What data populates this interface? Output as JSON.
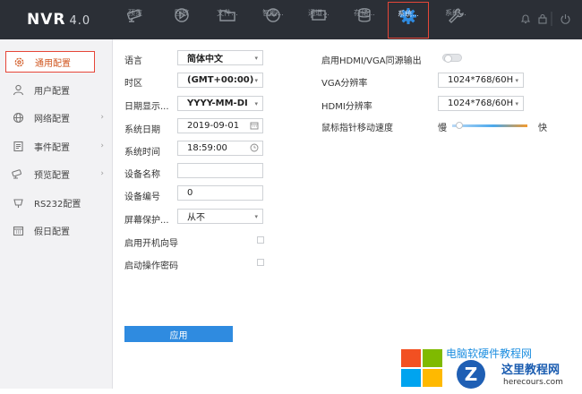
{
  "brand": {
    "name": "NVR",
    "version": "4.0"
  },
  "topnav": [
    {
      "id": "preview",
      "label": "预览",
      "icon": "camera-icon"
    },
    {
      "id": "playback",
      "label": "回放",
      "icon": "play-icon"
    },
    {
      "id": "file",
      "label": "文件...",
      "icon": "folder-icon"
    },
    {
      "id": "smart",
      "label": "智能...",
      "icon": "smart-analysis-icon"
    },
    {
      "id": "channel",
      "label": "通道...",
      "icon": "channel-icon"
    },
    {
      "id": "storage",
      "label": "存储...",
      "icon": "database-icon"
    },
    {
      "id": "system",
      "label": "系统...",
      "icon": "gear-icon",
      "active": true
    },
    {
      "id": "maintenance",
      "label": "系统...",
      "icon": "wrench-icon"
    }
  ],
  "sidebar": {
    "items": [
      {
        "label": "通用配置",
        "icon": "gear-icon",
        "active": true,
        "arrow": false
      },
      {
        "label": "用户配置",
        "icon": "user-icon",
        "arrow": false
      },
      {
        "label": "网络配置",
        "icon": "globe-icon",
        "arrow": true
      },
      {
        "label": "事件配置",
        "icon": "event-icon",
        "arrow": true
      },
      {
        "label": "预览配置",
        "icon": "camera-icon",
        "arrow": true
      },
      {
        "label": "RS232配置",
        "icon": "rs232-icon",
        "arrow": false
      },
      {
        "label": "假日配置",
        "icon": "calendar-icon",
        "arrow": false
      }
    ]
  },
  "form": {
    "language": {
      "label": "语言",
      "value": "简体中文"
    },
    "timezone": {
      "label": "时区",
      "value": "(GMT+00:00)"
    },
    "date_format": {
      "label": "日期显示...",
      "value": "YYYY-MM-DI"
    },
    "system_date": {
      "label": "系统日期",
      "value": "2019-09-01"
    },
    "system_time": {
      "label": "系统时间",
      "value": "18:59:00"
    },
    "device_name": {
      "label": "设备名称",
      "value": ""
    },
    "device_number": {
      "label": "设备编号",
      "value": "0"
    },
    "screensaver": {
      "label": "屏幕保护...",
      "value": "从不"
    },
    "startup_wizard": {
      "label": "启用开机向导",
      "checked": false
    },
    "operation_password": {
      "label": "启动操作密码",
      "checked": false
    },
    "hdmi_vga_sync": {
      "label": "启用HDMI/VGA同源输出",
      "on": false
    },
    "vga_resolution": {
      "label": "VGA分辨率",
      "value": "1024*768/60H"
    },
    "hdmi_resolution": {
      "label": "HDMI分辨率",
      "value": "1024*768/60H"
    },
    "mouse_speed": {
      "label": "鼠标指针移动速度",
      "min_label": "慢",
      "max_label": "快",
      "level": 0.05
    },
    "apply_label": "应用"
  },
  "watermark": {
    "line1": "电脑软硬件教程网",
    "line2": "这里教程网",
    "line3": "herecours.com"
  },
  "colors": {
    "topbar": "#2b2f36",
    "accent": "#2f8be0",
    "highlight": "#e64638",
    "sidebar": "#f2f2f4"
  }
}
